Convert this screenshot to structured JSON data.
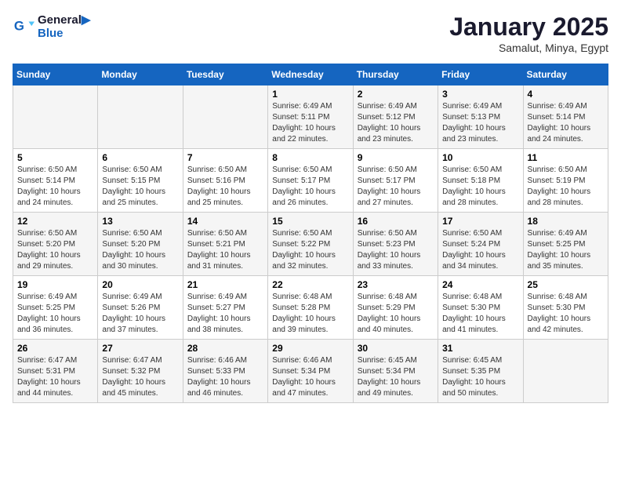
{
  "header": {
    "logo_line1": "General",
    "logo_line2": "Blue",
    "month": "January 2025",
    "location": "Samalut, Minya, Egypt"
  },
  "days_of_week": [
    "Sunday",
    "Monday",
    "Tuesday",
    "Wednesday",
    "Thursday",
    "Friday",
    "Saturday"
  ],
  "weeks": [
    [
      {
        "day": "",
        "info": ""
      },
      {
        "day": "",
        "info": ""
      },
      {
        "day": "",
        "info": ""
      },
      {
        "day": "1",
        "info": "Sunrise: 6:49 AM\nSunset: 5:11 PM\nDaylight: 10 hours\nand 22 minutes."
      },
      {
        "day": "2",
        "info": "Sunrise: 6:49 AM\nSunset: 5:12 PM\nDaylight: 10 hours\nand 23 minutes."
      },
      {
        "day": "3",
        "info": "Sunrise: 6:49 AM\nSunset: 5:13 PM\nDaylight: 10 hours\nand 23 minutes."
      },
      {
        "day": "4",
        "info": "Sunrise: 6:49 AM\nSunset: 5:14 PM\nDaylight: 10 hours\nand 24 minutes."
      }
    ],
    [
      {
        "day": "5",
        "info": "Sunrise: 6:50 AM\nSunset: 5:14 PM\nDaylight: 10 hours\nand 24 minutes."
      },
      {
        "day": "6",
        "info": "Sunrise: 6:50 AM\nSunset: 5:15 PM\nDaylight: 10 hours\nand 25 minutes."
      },
      {
        "day": "7",
        "info": "Sunrise: 6:50 AM\nSunset: 5:16 PM\nDaylight: 10 hours\nand 25 minutes."
      },
      {
        "day": "8",
        "info": "Sunrise: 6:50 AM\nSunset: 5:17 PM\nDaylight: 10 hours\nand 26 minutes."
      },
      {
        "day": "9",
        "info": "Sunrise: 6:50 AM\nSunset: 5:17 PM\nDaylight: 10 hours\nand 27 minutes."
      },
      {
        "day": "10",
        "info": "Sunrise: 6:50 AM\nSunset: 5:18 PM\nDaylight: 10 hours\nand 28 minutes."
      },
      {
        "day": "11",
        "info": "Sunrise: 6:50 AM\nSunset: 5:19 PM\nDaylight: 10 hours\nand 28 minutes."
      }
    ],
    [
      {
        "day": "12",
        "info": "Sunrise: 6:50 AM\nSunset: 5:20 PM\nDaylight: 10 hours\nand 29 minutes."
      },
      {
        "day": "13",
        "info": "Sunrise: 6:50 AM\nSunset: 5:20 PM\nDaylight: 10 hours\nand 30 minutes."
      },
      {
        "day": "14",
        "info": "Sunrise: 6:50 AM\nSunset: 5:21 PM\nDaylight: 10 hours\nand 31 minutes."
      },
      {
        "day": "15",
        "info": "Sunrise: 6:50 AM\nSunset: 5:22 PM\nDaylight: 10 hours\nand 32 minutes."
      },
      {
        "day": "16",
        "info": "Sunrise: 6:50 AM\nSunset: 5:23 PM\nDaylight: 10 hours\nand 33 minutes."
      },
      {
        "day": "17",
        "info": "Sunrise: 6:50 AM\nSunset: 5:24 PM\nDaylight: 10 hours\nand 34 minutes."
      },
      {
        "day": "18",
        "info": "Sunrise: 6:49 AM\nSunset: 5:25 PM\nDaylight: 10 hours\nand 35 minutes."
      }
    ],
    [
      {
        "day": "19",
        "info": "Sunrise: 6:49 AM\nSunset: 5:25 PM\nDaylight: 10 hours\nand 36 minutes."
      },
      {
        "day": "20",
        "info": "Sunrise: 6:49 AM\nSunset: 5:26 PM\nDaylight: 10 hours\nand 37 minutes."
      },
      {
        "day": "21",
        "info": "Sunrise: 6:49 AM\nSunset: 5:27 PM\nDaylight: 10 hours\nand 38 minutes."
      },
      {
        "day": "22",
        "info": "Sunrise: 6:48 AM\nSunset: 5:28 PM\nDaylight: 10 hours\nand 39 minutes."
      },
      {
        "day": "23",
        "info": "Sunrise: 6:48 AM\nSunset: 5:29 PM\nDaylight: 10 hours\nand 40 minutes."
      },
      {
        "day": "24",
        "info": "Sunrise: 6:48 AM\nSunset: 5:30 PM\nDaylight: 10 hours\nand 41 minutes."
      },
      {
        "day": "25",
        "info": "Sunrise: 6:48 AM\nSunset: 5:30 PM\nDaylight: 10 hours\nand 42 minutes."
      }
    ],
    [
      {
        "day": "26",
        "info": "Sunrise: 6:47 AM\nSunset: 5:31 PM\nDaylight: 10 hours\nand 44 minutes."
      },
      {
        "day": "27",
        "info": "Sunrise: 6:47 AM\nSunset: 5:32 PM\nDaylight: 10 hours\nand 45 minutes."
      },
      {
        "day": "28",
        "info": "Sunrise: 6:46 AM\nSunset: 5:33 PM\nDaylight: 10 hours\nand 46 minutes."
      },
      {
        "day": "29",
        "info": "Sunrise: 6:46 AM\nSunset: 5:34 PM\nDaylight: 10 hours\nand 47 minutes."
      },
      {
        "day": "30",
        "info": "Sunrise: 6:45 AM\nSunset: 5:34 PM\nDaylight: 10 hours\nand 49 minutes."
      },
      {
        "day": "31",
        "info": "Sunrise: 6:45 AM\nSunset: 5:35 PM\nDaylight: 10 hours\nand 50 minutes."
      },
      {
        "day": "",
        "info": ""
      }
    ]
  ]
}
